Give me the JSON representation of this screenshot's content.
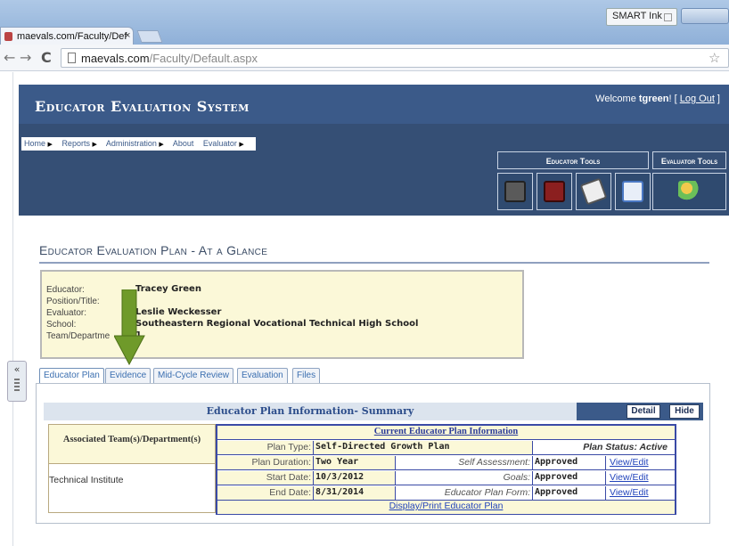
{
  "browser": {
    "tab_title": "maevals.com/Faculty/Def",
    "tab_close": "×",
    "smart_ink": "SMART Ink",
    "url_host": "maevals.com",
    "url_path": "/Faculty/Default.aspx",
    "back_glyph": "←",
    "forward_glyph": "→",
    "reload_glyph": "C",
    "bookmark_glyph": "☆"
  },
  "header": {
    "system_title": "Educator Evaluation System",
    "welcome_prefix": "Welcome ",
    "user": "tgreen",
    "welcome_suffix": "! [ ",
    "logout": "Log Out",
    "logout_close": " ]"
  },
  "menu": {
    "items": [
      "Home",
      "Reports",
      "Administration",
      "About",
      "Evaluator"
    ],
    "arrow": "▶"
  },
  "tools": {
    "educator_tools": "Educator Tools",
    "evaluator_tools": "Evaluator Tools",
    "icons": [
      "cabinet-icon",
      "toolbox-icon",
      "checklist-icon",
      "id-card-icon",
      "people-icon"
    ]
  },
  "plan": {
    "section_title": "Educator Evaluation Plan - At a Glance",
    "fields": [
      {
        "label": "Educator:",
        "value": "Tracey   Green"
      },
      {
        "label": "Position/Title:",
        "value": ""
      },
      {
        "label": "Evaluator:",
        "value": "Leslie   Weckesser"
      },
      {
        "label": "School:",
        "value": "Southeastern Regional Vocational Technical High School"
      },
      {
        "label": "Team/Departme",
        "value": "1"
      }
    ]
  },
  "tabs": [
    "Educator Plan",
    "Evidence",
    "Mid-Cycle Review",
    "Evaluation",
    "Files"
  ],
  "summary": {
    "title": "Educator Plan Information- Summary",
    "detail_button": "Detail",
    "hide_button": "Hide",
    "assoc_header": "Associated Team(s)/Department(s)",
    "assoc_value": "Technical Institute",
    "current_header": "Current Educator Plan Information",
    "rows": [
      {
        "label": "Plan Type:",
        "value": "Self-Directed Growth Plan",
        "status": "Plan Status: Active"
      },
      {
        "label": "Plan Duration:",
        "value": "Two Year",
        "item": "Self Assessment:",
        "item_value": "Approved",
        "link": "View/Edit"
      },
      {
        "label": "Start Date:",
        "value": "10/3/2012",
        "item": "Goals:",
        "item_value": "Approved",
        "link": "View/Edit"
      },
      {
        "label": "End Date:",
        "value": "8/31/2014",
        "item": "Educator Plan Form:",
        "item_value": "Approved",
        "link": "View/Edit"
      }
    ],
    "print_link": "Display/Print Educator Plan"
  },
  "colors": {
    "banner": "#3b5a89",
    "nav": "#354f75",
    "panel_yellow": "#fbf8d8",
    "arrow_green": "#6f9a2a"
  }
}
